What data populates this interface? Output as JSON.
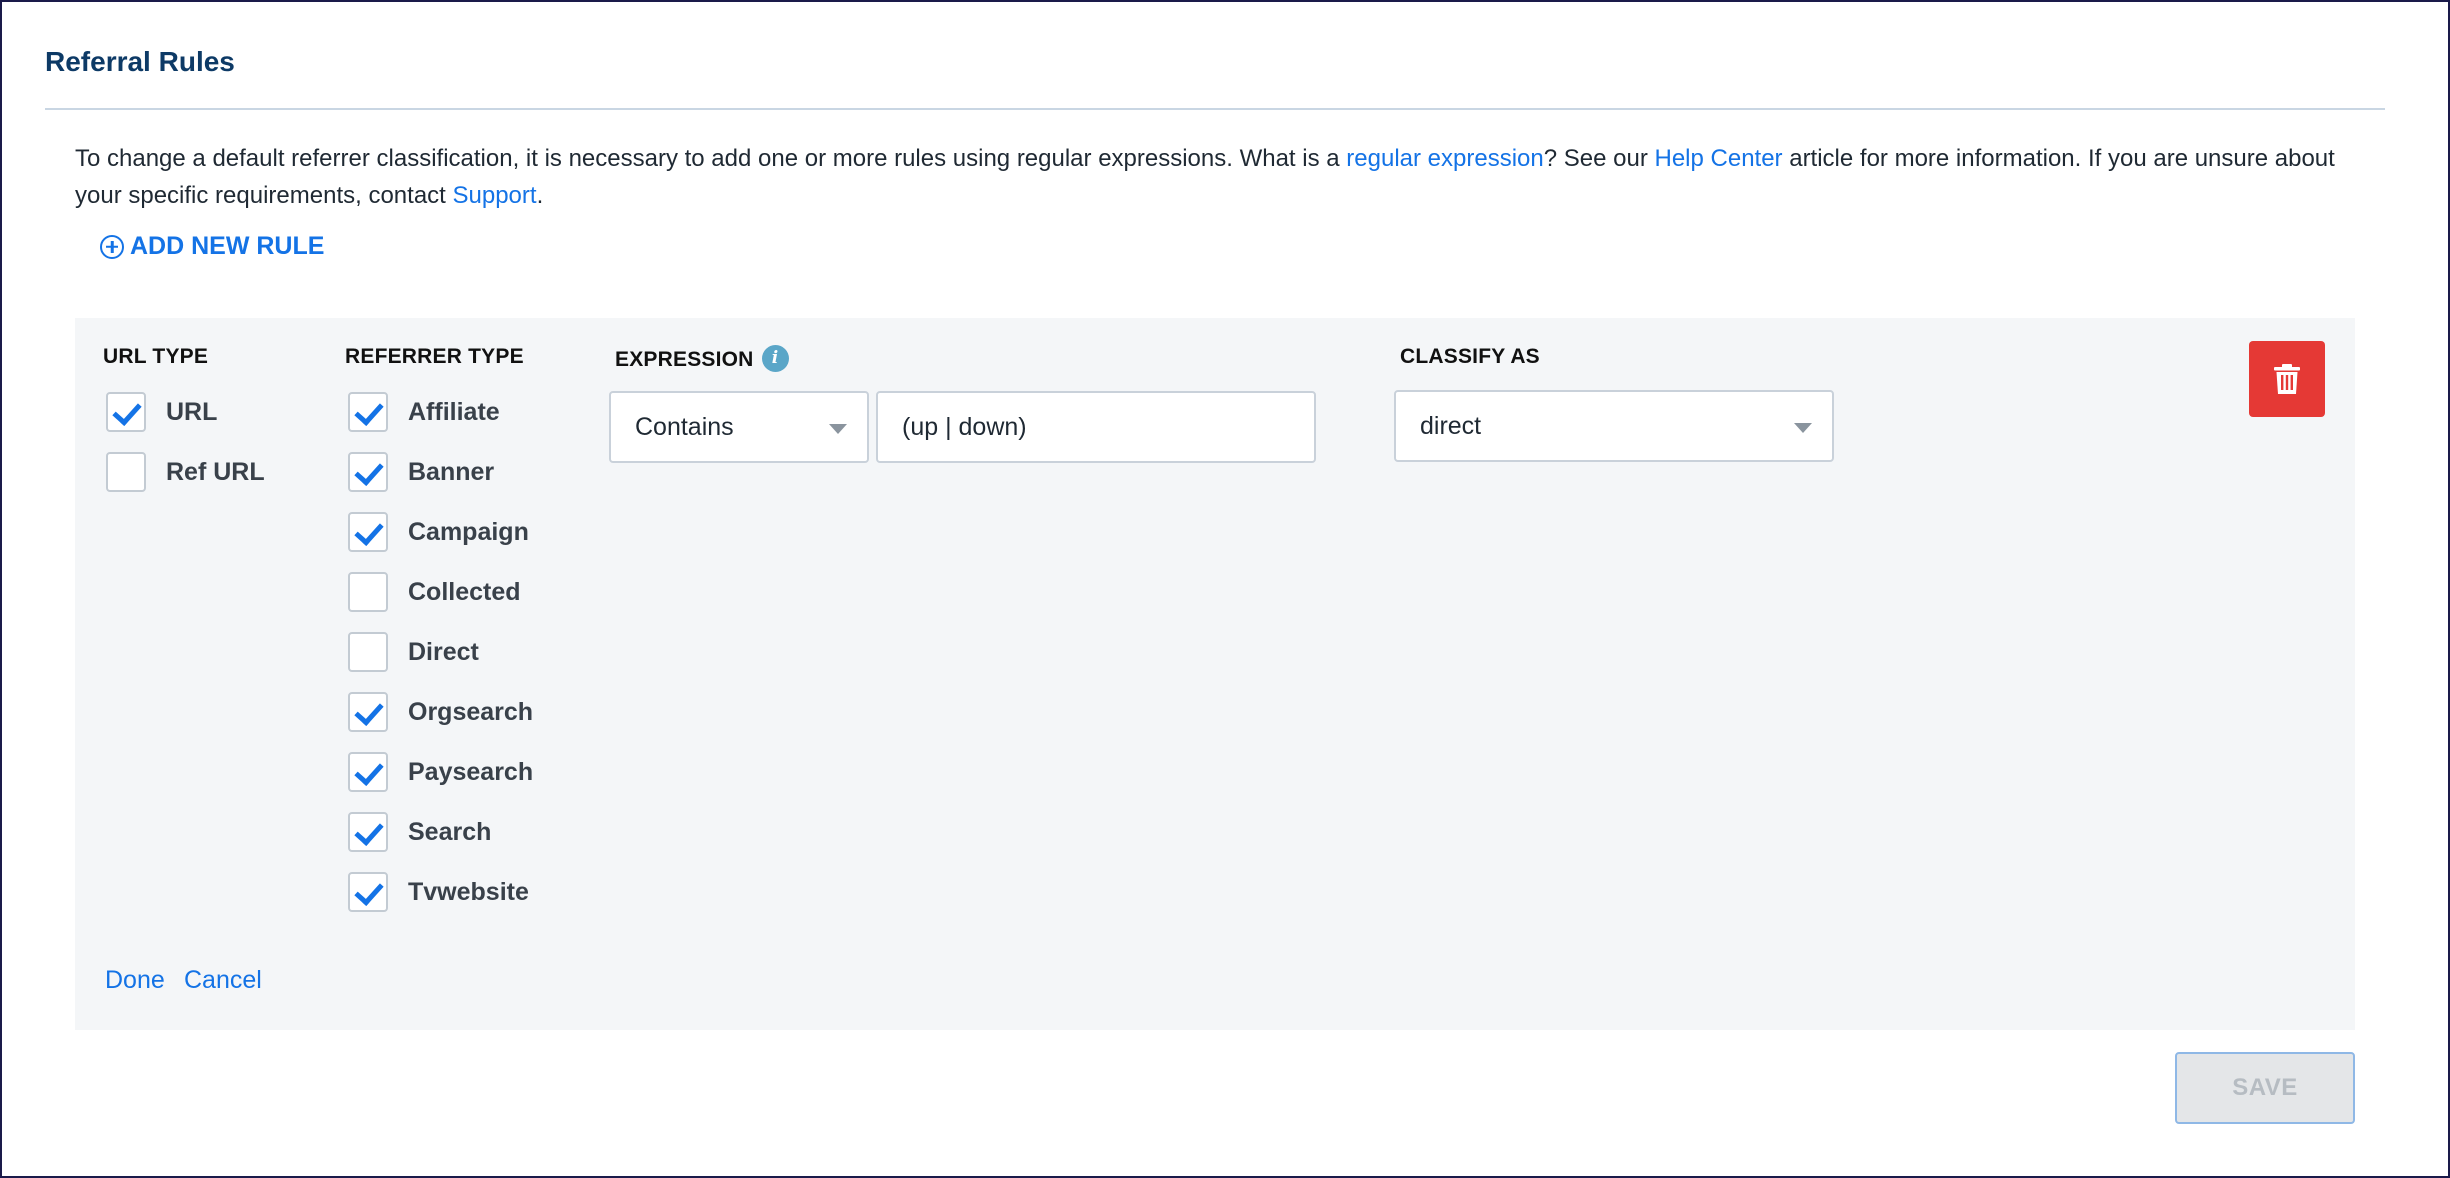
{
  "page": {
    "title": "Referral Rules",
    "intro": {
      "part1": "To change a default referrer classification, it is necessary to add one or more rules using regular expressions. What is a ",
      "link1": "regular expression",
      "part2": "? See our ",
      "link2": "Help Center",
      "part3": " article for more information. If you are unsure about your specific requirements, contact ",
      "link3": "Support",
      "part4": "."
    },
    "add_rule_label": "ADD NEW RULE"
  },
  "rule": {
    "url_type": {
      "header": "URL TYPE",
      "options": [
        {
          "label": "URL",
          "checked": true
        },
        {
          "label": "Ref URL",
          "checked": false
        }
      ]
    },
    "referrer_type": {
      "header": "REFERRER TYPE",
      "options": [
        {
          "label": "Affiliate",
          "checked": true
        },
        {
          "label": "Banner",
          "checked": true
        },
        {
          "label": "Campaign",
          "checked": true
        },
        {
          "label": "Collected",
          "checked": false
        },
        {
          "label": "Direct",
          "checked": false
        },
        {
          "label": "Orgsearch",
          "checked": true
        },
        {
          "label": "Paysearch",
          "checked": true
        },
        {
          "label": "Search",
          "checked": true
        },
        {
          "label": "Tvwebsite",
          "checked": true
        }
      ]
    },
    "expression": {
      "header": "EXPRESSION",
      "info_icon": "info-icon",
      "operator": "Contains",
      "value": "(up | down)"
    },
    "classify_as": {
      "header": "CLASSIFY AS",
      "value": "direct"
    },
    "delete_icon": "trash-icon",
    "done_label": "Done",
    "cancel_label": "Cancel"
  },
  "footer": {
    "save_label": "SAVE"
  },
  "colors": {
    "accent": "#1473e6",
    "delete": "#e53935",
    "title": "#0d3a66"
  }
}
